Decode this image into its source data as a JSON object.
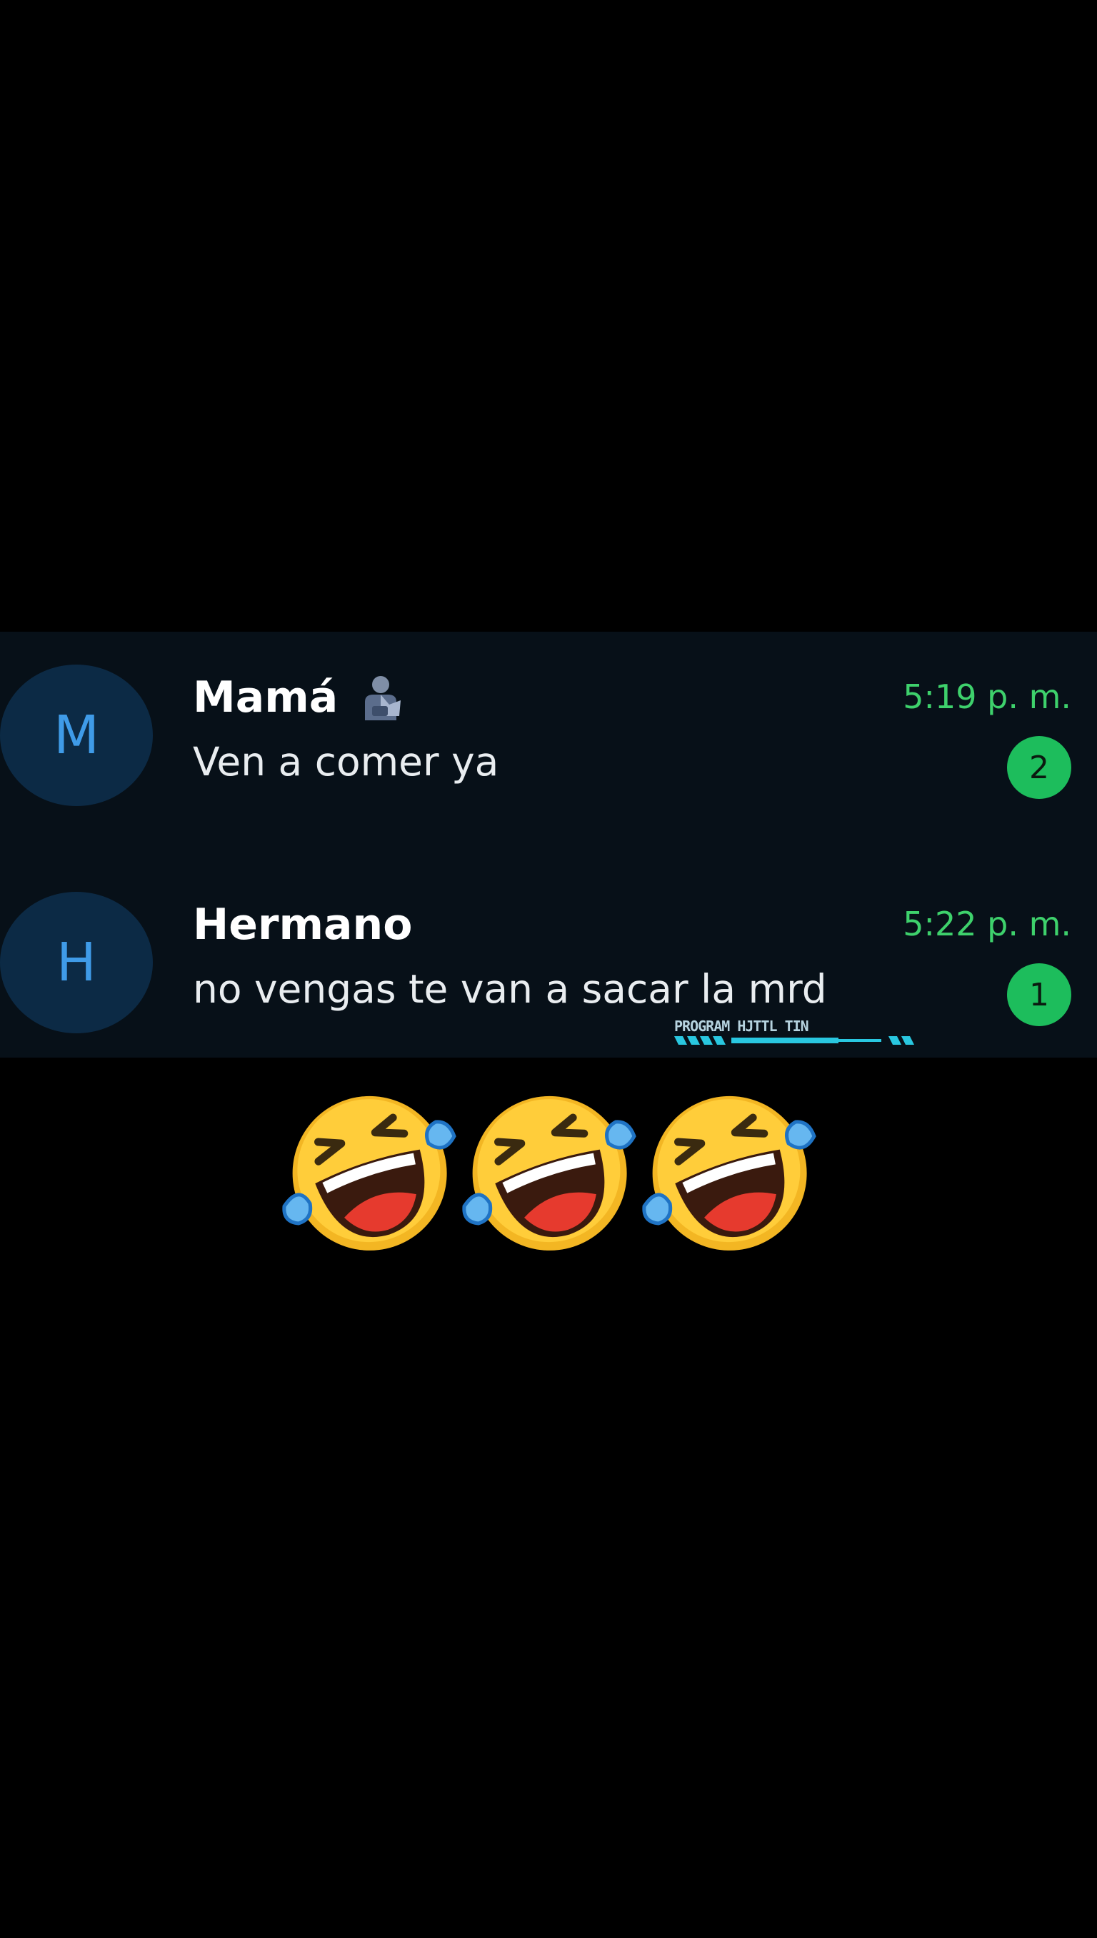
{
  "chats": [
    {
      "avatar_letter": "M",
      "name": "Mamá",
      "name_icon": "person-icon",
      "preview": "Ven a comer ya",
      "time": "5:19 p. m.",
      "unread": "2"
    },
    {
      "avatar_letter": "H",
      "name": "Hermano",
      "preview": "no vengas te van a sacar la mrd",
      "time": "5:22 p. m.",
      "unread": "1"
    }
  ],
  "watermark": {
    "text": "PROGRAM HJTTL TIN"
  },
  "reaction": {
    "emoji_name": "rolling-on-the-floor-laughing-icon",
    "count": 3
  },
  "colors": {
    "background": "#000000",
    "panel": "#071018",
    "avatar_bg": "#0c2a45",
    "avatar_letter": "#3f9be8",
    "time": "#3ed16c",
    "badge": "#1dbd5c"
  }
}
